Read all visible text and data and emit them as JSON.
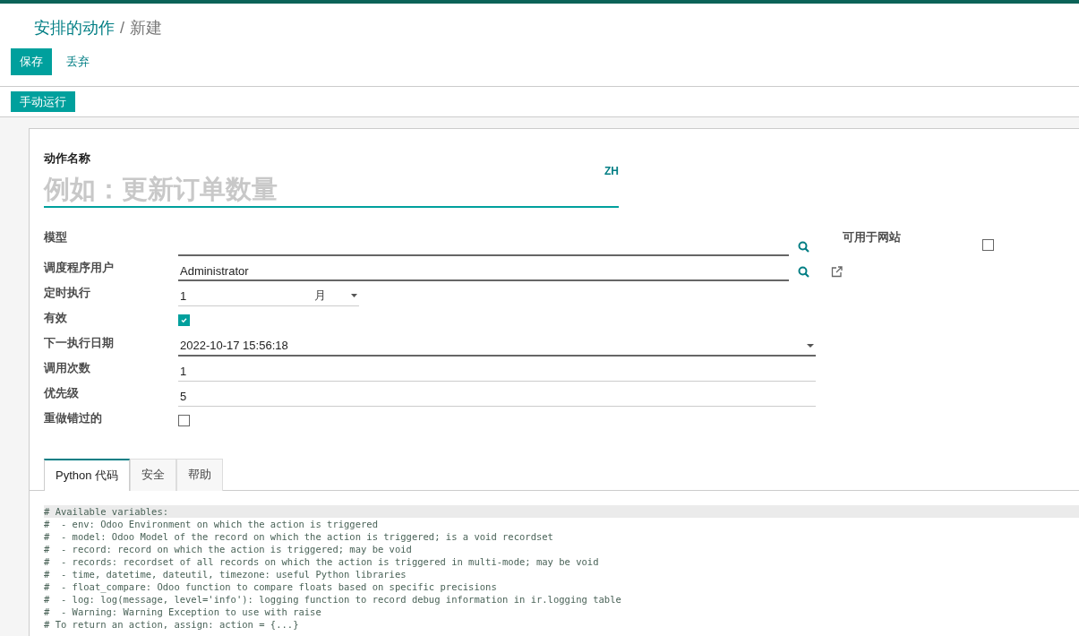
{
  "breadcrumb": {
    "parent": "安排的动作",
    "separator": "/",
    "current": "新建"
  },
  "control_buttons": {
    "save": "保存",
    "discard": "丢弃"
  },
  "action_buttons": [
    "手动运行"
  ],
  "form": {
    "name_label": "动作名称",
    "name_placeholder": "例如：更新订单数量",
    "language": "ZH",
    "fields": [
      {
        "kind": "many2one",
        "label": "模型",
        "external_link": false
      },
      {
        "kind": "many2one",
        "label": "调度程序用户",
        "value": "Administrator",
        "external_link": true
      },
      {
        "kind": "interval",
        "label": "定时执行",
        "value": "1",
        "unit": "月"
      },
      {
        "kind": "checkbox",
        "label": "有效",
        "checked": true
      },
      {
        "kind": "datetime",
        "label": "下一执行日期",
        "value": "2022-10-17 15:56:18"
      },
      {
        "kind": "text",
        "label": "调用次数",
        "value": "1"
      },
      {
        "kind": "text",
        "label": "优先级",
        "value": "5"
      },
      {
        "kind": "checkbox",
        "label": "重做错过的",
        "checked": false
      }
    ],
    "side_fields": [
      {
        "kind": "checkbox",
        "label": "可用于网站",
        "checked": false
      }
    ],
    "tabs": [
      {
        "label": "Python 代码",
        "selected": true
      },
      {
        "label": "安全",
        "selected": false
      },
      {
        "label": "帮助",
        "selected": false
      }
    ],
    "code_lines": [
      {
        "text": "# Available variables:",
        "active": true
      },
      {
        "text": "#  - env: Odoo Environment on which the action is triggered",
        "active": false
      },
      {
        "text": "#  - model: Odoo Model of the record on which the action is triggered; is a void recordset",
        "active": false
      },
      {
        "text": "#  - record: record on which the action is triggered; may be void",
        "active": false
      },
      {
        "text": "#  - records: recordset of all records on which the action is triggered in multi-mode; may be void",
        "active": false
      },
      {
        "text": "#  - time, datetime, dateutil, timezone: useful Python libraries",
        "active": false
      },
      {
        "text": "#  - float_compare: Odoo function to compare floats based on specific precisions",
        "active": false
      },
      {
        "text": "#  - log: log(message, level='info'): logging function to record debug information in ir.logging table",
        "active": false
      },
      {
        "text": "#  - Warning: Warning Exception to use with raise",
        "active": false
      },
      {
        "text": "# To return an action, assign: action = {...}",
        "active": false
      }
    ]
  }
}
